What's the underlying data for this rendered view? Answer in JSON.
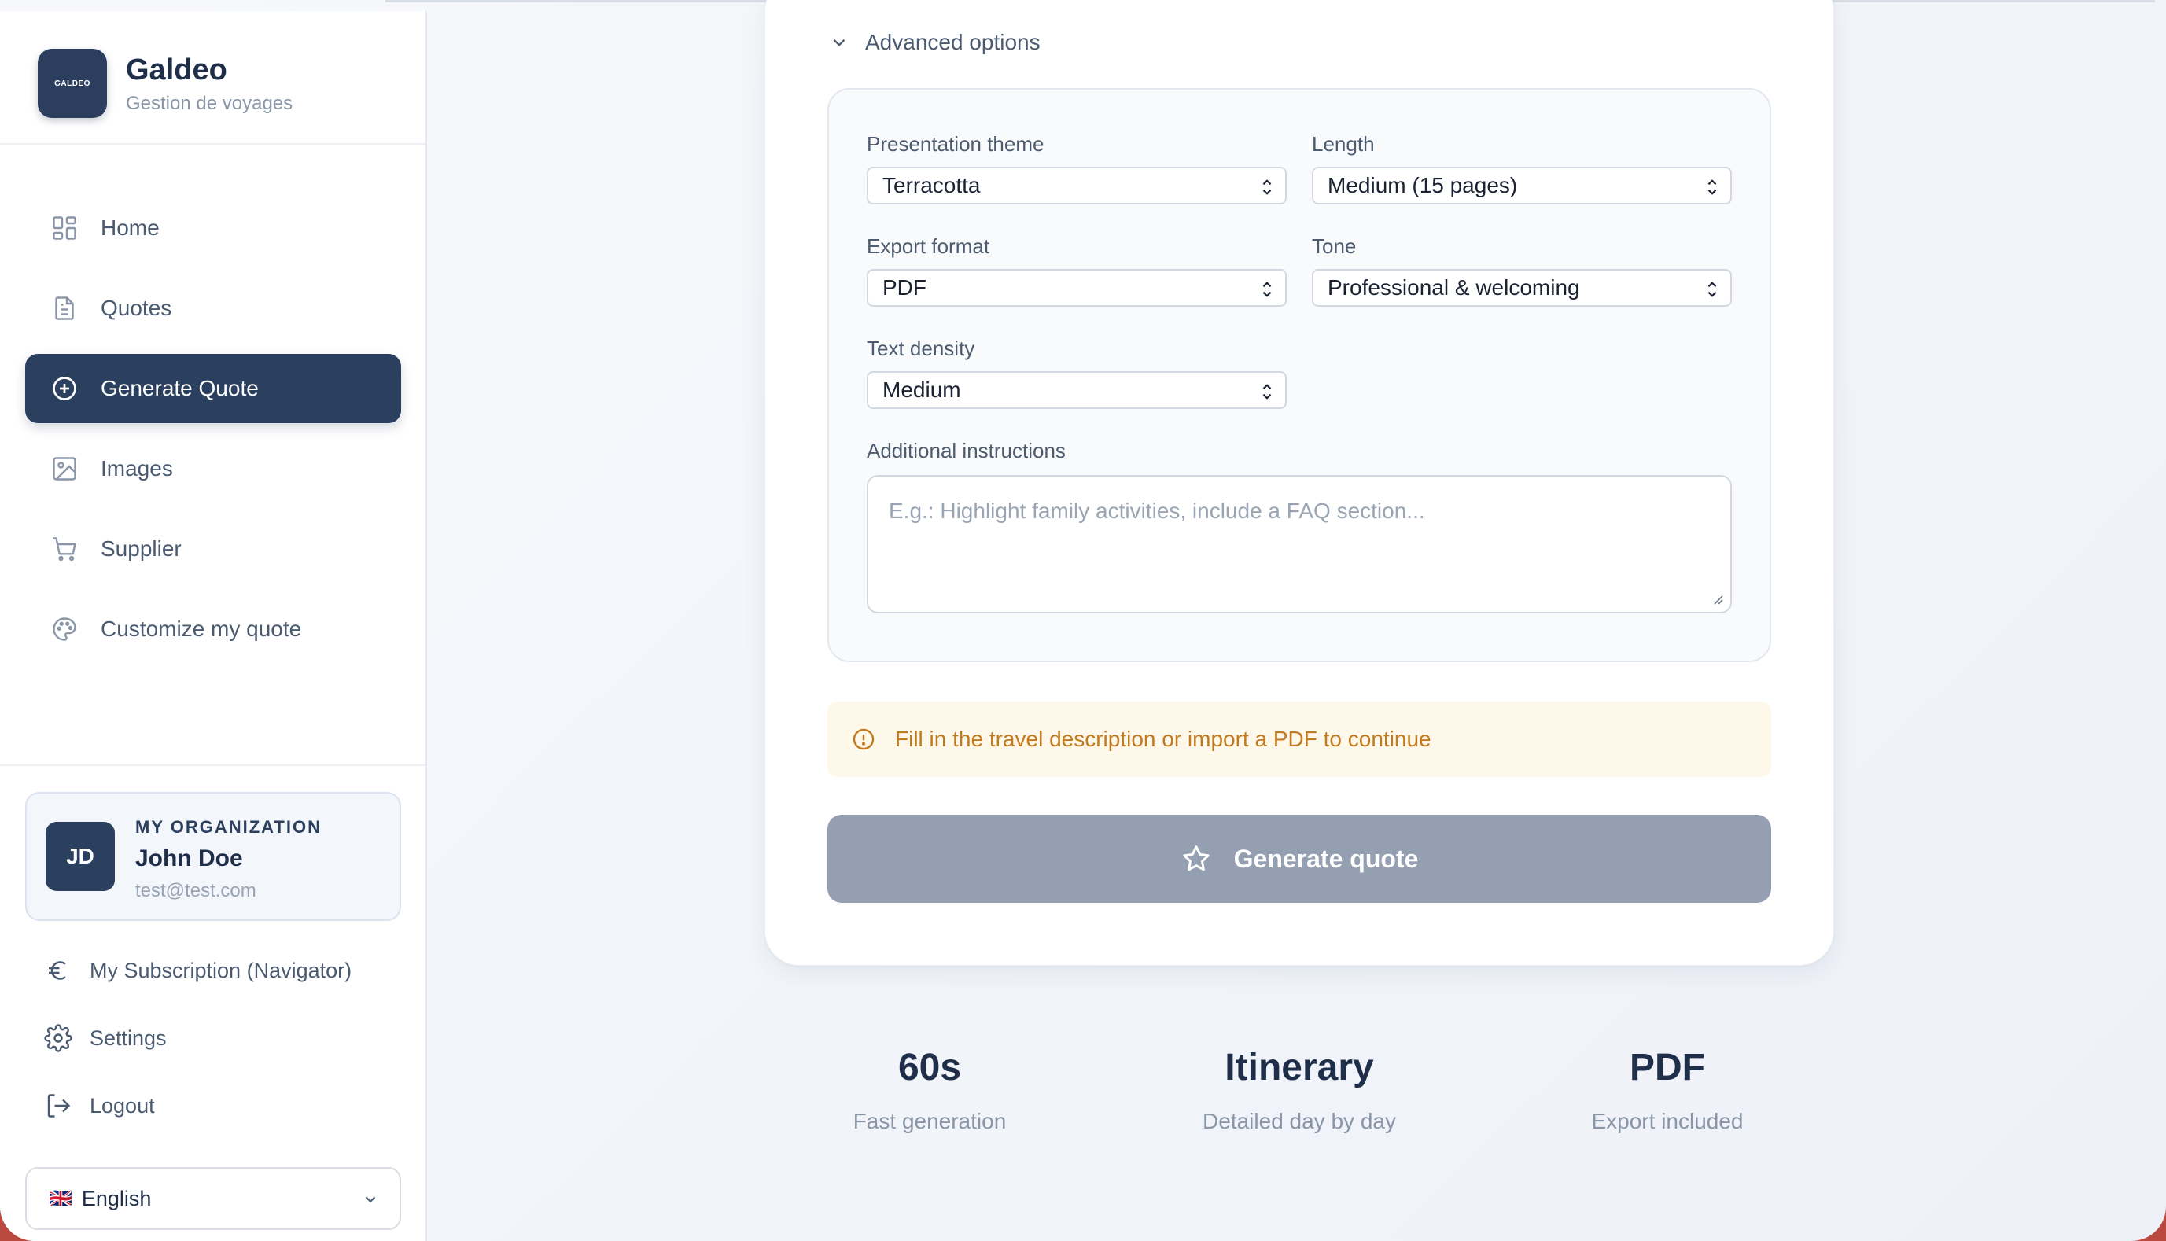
{
  "brand": {
    "logo_text": "GALDEO",
    "title": "Galdeo",
    "subtitle": "Gestion de voyages"
  },
  "sidebar": {
    "items": [
      {
        "label": "Home",
        "icon": "grid-icon"
      },
      {
        "label": "Quotes",
        "icon": "document-icon"
      },
      {
        "label": "Generate Quote",
        "icon": "plus-circle-icon",
        "active": true
      },
      {
        "label": "Images",
        "icon": "image-icon"
      },
      {
        "label": "Supplier",
        "icon": "cart-icon"
      },
      {
        "label": "Customize my quote",
        "icon": "palette-icon"
      }
    ],
    "org": {
      "initials": "JD",
      "label": "MY ORGANIZATION",
      "name": "John Doe",
      "email": "test@test.com"
    },
    "links": {
      "subscription": "My Subscription (Navigator)",
      "settings": "Settings",
      "logout": "Logout"
    },
    "language": {
      "flag": "🇬🇧",
      "value": "English"
    }
  },
  "advanced": {
    "toggle_label": "Advanced options",
    "theme": {
      "label": "Presentation theme",
      "value": "Terracotta"
    },
    "length": {
      "label": "Length",
      "value": "Medium (15 pages)"
    },
    "export": {
      "label": "Export format",
      "value": "PDF"
    },
    "tone": {
      "label": "Tone",
      "value": "Professional & welcoming"
    },
    "density": {
      "label": "Text density",
      "value": "Medium"
    },
    "instructions": {
      "label": "Additional instructions",
      "placeholder": "E.g.: Highlight family activities, include a FAQ section..."
    }
  },
  "warning": "Fill in the travel description or import a PDF to continue",
  "generate_button": "Generate quote",
  "stats": [
    {
      "value": "60s",
      "label": "Fast generation"
    },
    {
      "value": "Itinerary",
      "label": "Detailed day by day"
    },
    {
      "value": "PDF",
      "label": "Export included"
    }
  ],
  "colors": {
    "primary": "#2b3f5f",
    "warning_text": "#c27a1e",
    "warning_bg": "#fef8ea",
    "button_disabled": "#94a0b2"
  }
}
